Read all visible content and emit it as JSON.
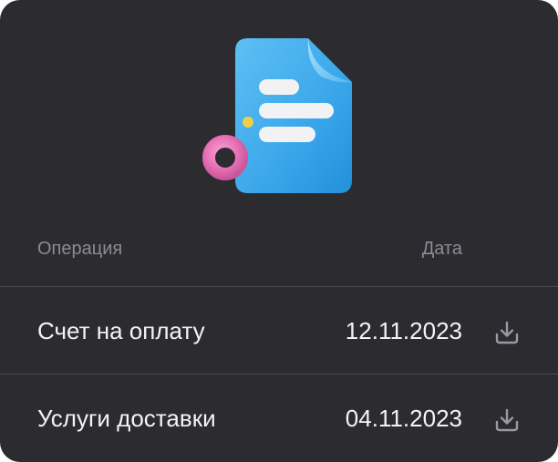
{
  "table": {
    "header": {
      "operation": "Операция",
      "date": "Дата"
    },
    "rows": [
      {
        "name": "Счет на оплату",
        "date": "12.11.2023",
        "action_icon": "download-icon"
      },
      {
        "name": "Услуги доставки",
        "date": "04.11.2023",
        "action_icon": "download-icon"
      }
    ]
  },
  "hero": {
    "illustration_icon": "document-icon",
    "ring_icon": "ring-icon"
  },
  "colors": {
    "background": "#2b2b30",
    "text_primary": "#f4f4f6",
    "text_secondary": "#8b8b93",
    "divider": "#4a4a51",
    "document": "#3aa6ea",
    "ring": "#e871b6",
    "dot": "#f1cf46"
  }
}
